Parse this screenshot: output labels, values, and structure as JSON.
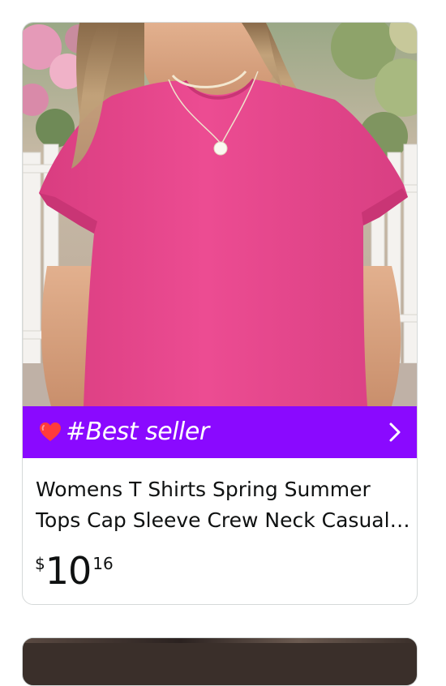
{
  "product": {
    "image_alt": "Pink crew neck cap sleeve t-shirt worn by model",
    "badge": {
      "label": "#Best seller",
      "icon": "heart-icon",
      "color": "#8a09ff"
    },
    "title": "Womens T Shirts Spring Summer Tops Cap Sleeve Crew Neck Casual Basic Tee",
    "price": {
      "symbol": "$",
      "whole": "10",
      "fraction": "16"
    }
  },
  "colors": {
    "shirt": "#ea4a8f",
    "badge_bg": "#8a09ff",
    "text": "#0f1111"
  }
}
